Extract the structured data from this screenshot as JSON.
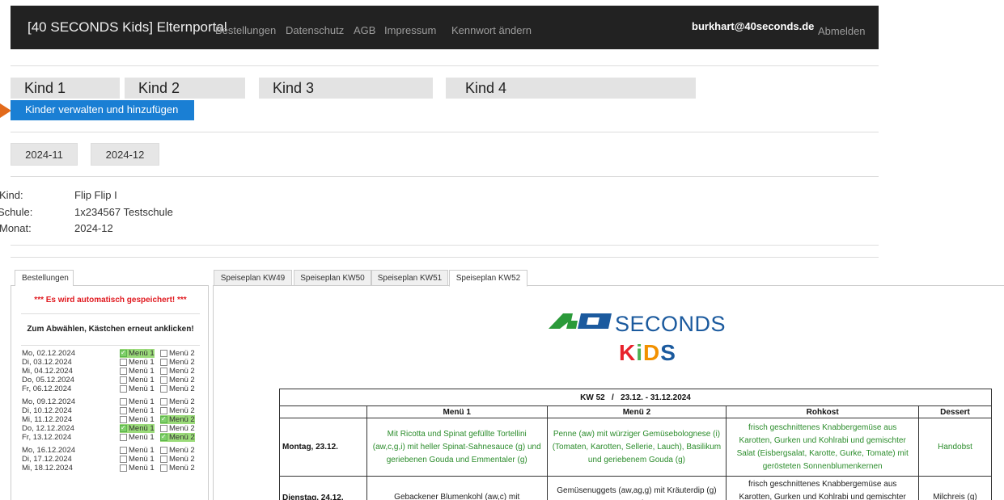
{
  "navbar": {
    "brand": "[40 SECONDS Kids] Elternportal",
    "links": [
      "Bestellungen",
      "Datenschutz",
      "AGB",
      "Impressum",
      "Kennwort ändern"
    ],
    "user": "burkhart@40seconds.de",
    "logout": "Abmelden"
  },
  "children": {
    "tabs": [
      "Kind 1",
      "Kind 2",
      "Kind 3",
      "Kind 4"
    ],
    "manage_button": "Kinder verwalten und hinzufügen"
  },
  "months": [
    "2024-11",
    "2024-12"
  ],
  "info": {
    "kind_label": "Kind:",
    "kind_value": "Flip Flip I",
    "schule_label": "Schule:",
    "schule_value": "1x234567 Testschule",
    "monat_label": "Monat:",
    "monat_value": "2024-12"
  },
  "orders": {
    "tab_label": "Bestellungen",
    "warning": "*** Es wird automatisch gespeichert! ***",
    "hint": "Zum Abwählen, Kästchen erneut anklicken!",
    "menu1_label": "Menü 1",
    "menu2_label": "Menü 2",
    "days": [
      {
        "date": "Mo, 02.12.2024",
        "m1": true,
        "m2": false
      },
      {
        "date": "Di, 03.12.2024",
        "m1": false,
        "m2": false
      },
      {
        "date": "Mi, 04.12.2024",
        "m1": false,
        "m2": false
      },
      {
        "date": "Do, 05.12.2024",
        "m1": false,
        "m2": false
      },
      {
        "date": "Fr, 06.12.2024",
        "m1": false,
        "m2": false
      },
      {
        "date": "Mo, 09.12.2024",
        "m1": false,
        "m2": false
      },
      {
        "date": "Di, 10.12.2024",
        "m1": false,
        "m2": false
      },
      {
        "date": "Mi, 11.12.2024",
        "m1": false,
        "m2": true
      },
      {
        "date": "Do, 12.12.2024",
        "m1": true,
        "m2": false
      },
      {
        "date": "Fr, 13.12.2024",
        "m1": false,
        "m2": true
      },
      {
        "date": "Mo, 16.12.2024",
        "m1": false,
        "m2": false
      },
      {
        "date": "Di, 17.12.2024",
        "m1": false,
        "m2": false
      },
      {
        "date": "Mi, 18.12.2024",
        "m1": false,
        "m2": false
      }
    ]
  },
  "speiseplan": {
    "tabs": [
      "Speiseplan KW49",
      "Speiseplan KW50",
      "Speiseplan KW51",
      "Speiseplan KW52"
    ],
    "active_tab": 3,
    "logo_text": "SECONDS",
    "logo_kids": [
      "K",
      "i",
      "D",
      "S"
    ],
    "logo_kids_colors": [
      "#e8212b",
      "#4caf50",
      "#f29100",
      "#1b5a9e"
    ],
    "logo_color_green": "#2b9a3a",
    "logo_color_blue": "#1b5a9e",
    "table_title": "KW 52   /   23.12. - 31.12.2024",
    "columns": [
      "Menü 1",
      "Menü 2",
      "Rohkost",
      "Dessert"
    ],
    "rows": [
      {
        "day": "Montag, 23.12.",
        "m1": "Mit Ricotta und Spinat gefüllte Tortellini (aw,c,g,i) mit heller Spinat-Sahnesauce (g) und geriebenen Gouda und Emmentaler (g)",
        "m2": "Penne (aw) mit würziger Gemüsebolognese (i) (Tomaten, Karotten, Sellerie, Lauch), Basilikum und geriebenem Gouda (g)",
        "rohkost": "frisch geschnittenes Knabbergemüse aus Karotten, Gurken und Kohlrabi und gemischter Salat (Eisbergsalat, Karotte, Gurke, Tomate) mit gerösteten Sonnenblumenkernen",
        "dessert": "Handobst"
      },
      {
        "day": "Dienstag, 24.12.",
        "m1": "Gebackener Blumenkohl (aw,c) mit",
        "m2": "Gemüsenuggets (aw,ag,g) mit Kräuterdip (g) und",
        "rohkost": "frisch geschnittenes Knabbergemüse aus Karotten, Gurken und Kohlrabi und gemischter Salat (Eisbergsalat,",
        "dessert": "Milchreis (g)"
      }
    ]
  }
}
